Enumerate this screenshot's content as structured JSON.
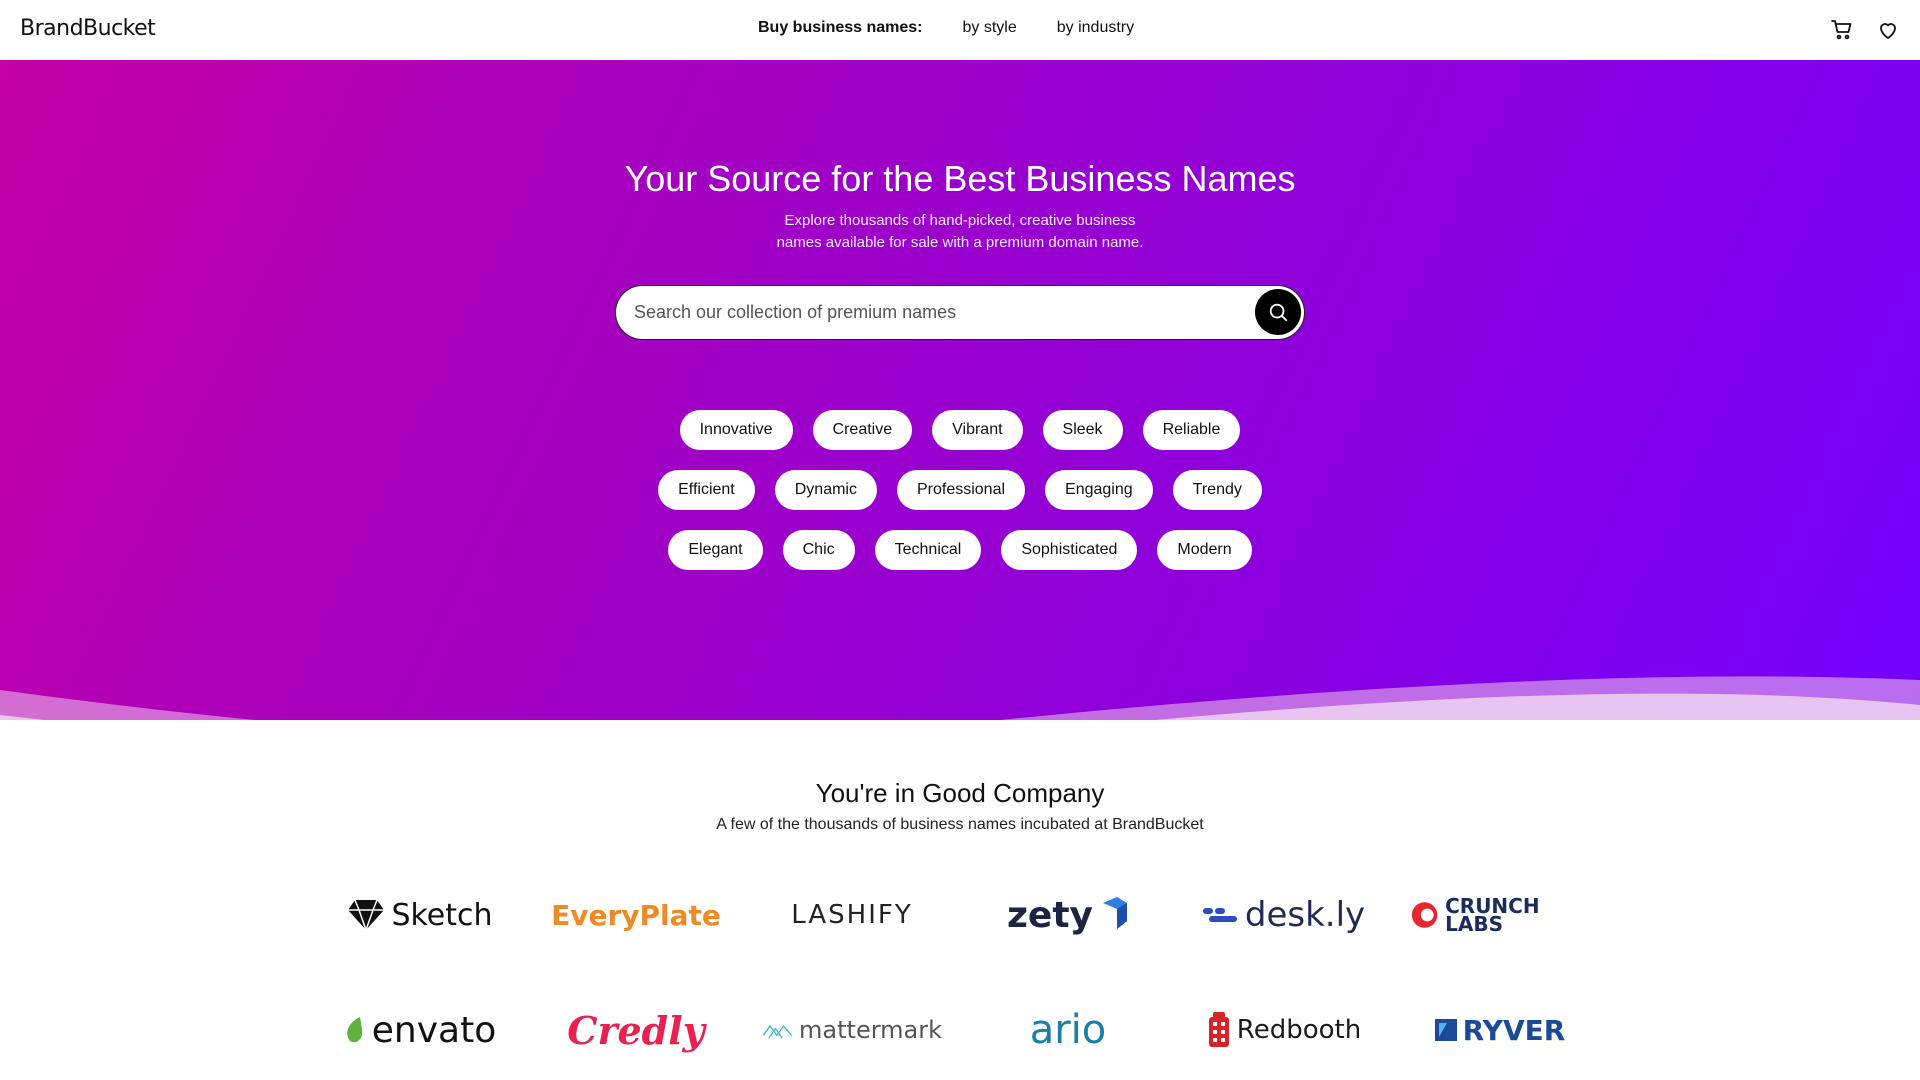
{
  "header": {
    "logo": "BrandBucket",
    "nav_label": "Buy business names:",
    "nav_links": [
      "by style",
      "by industry"
    ],
    "icons": [
      "cart-icon",
      "heart-icon"
    ]
  },
  "hero": {
    "title": "Your Source for the Best Business Names",
    "subtitle": "Explore thousands of hand-picked, creative business names available for sale with a premium domain name.",
    "search_placeholder": "Search our collection of premium names",
    "search_icon": "search-icon",
    "tags": [
      [
        "Innovative",
        "Creative",
        "Vibrant",
        "Sleek",
        "Reliable"
      ],
      [
        "Efficient",
        "Dynamic",
        "Professional",
        "Engaging",
        "Trendy"
      ],
      [
        "Elegant",
        "Chic",
        "Technical",
        "Sophisticated",
        "Modern"
      ]
    ]
  },
  "company": {
    "title": "You're in Good Company",
    "subtitle": "A few of the thousands of business names incubated at BrandBucket",
    "logos_row1": [
      "Sketch",
      "EveryPlate",
      "LASHIFY",
      "zety",
      "desk.ly",
      "CRUNCH LABS"
    ],
    "logos_row2": [
      "envato",
      "Credly",
      "mattermark",
      "ario",
      "Redbooth",
      "RYVER"
    ]
  },
  "colors": {
    "hero_gradient_start": "#c400a6",
    "hero_gradient_end": "#7400ff"
  }
}
